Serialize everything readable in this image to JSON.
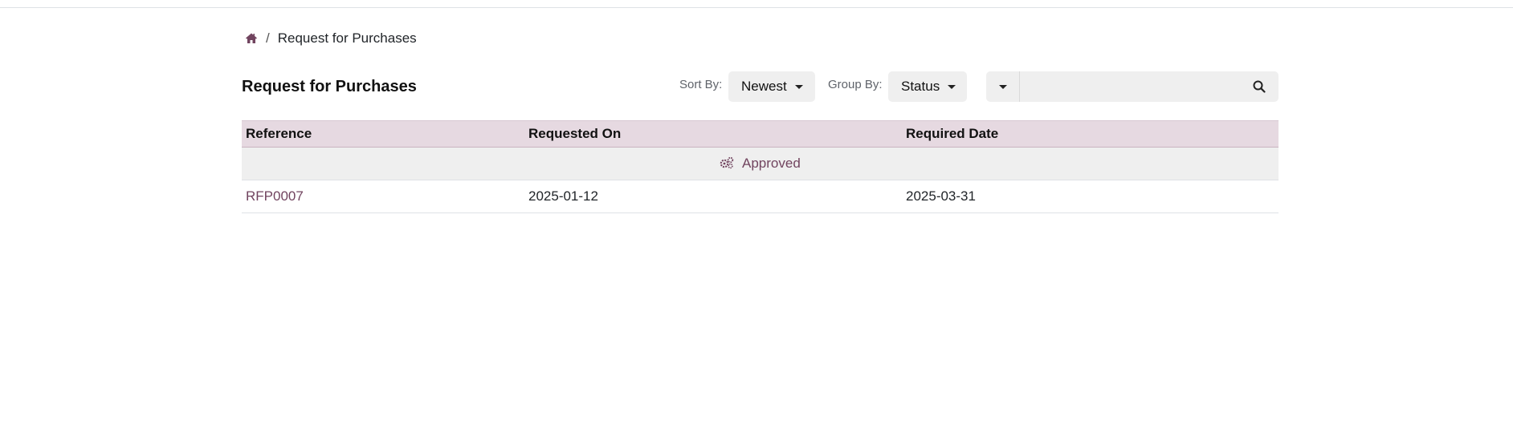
{
  "breadcrumb": {
    "home_icon": "home-icon",
    "separator": "/",
    "current": "Request for Purchases"
  },
  "header": {
    "title": "Request for Purchases",
    "sort_label": "Sort By:",
    "sort_value": "Newest",
    "group_label": "Group By:",
    "group_value": "Status",
    "search_placeholder": "",
    "search_icon": "search-icon"
  },
  "table": {
    "columns": [
      "Reference",
      "Requested On",
      "Required Date"
    ],
    "groups": [
      {
        "label": "Approved",
        "icon": "gears-icon",
        "rows": [
          {
            "reference": "RFP0007",
            "requested_on": "2025-01-12",
            "required_date": "2025-03-31"
          }
        ]
      }
    ]
  },
  "colors": {
    "accent": "#71445f",
    "header_bg": "#e6d9e1",
    "group_bg": "#efefef"
  }
}
